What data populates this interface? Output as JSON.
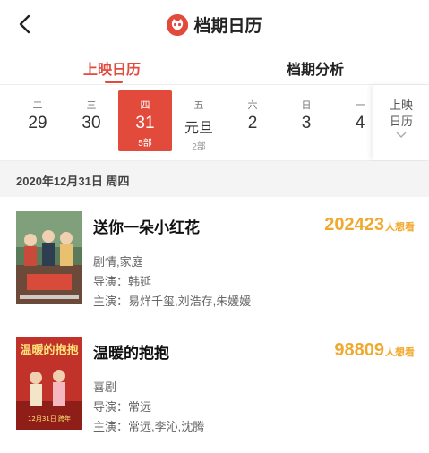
{
  "header": {
    "title": "档期日历",
    "back_icon": "back-arrow-icon",
    "logo_icon": "cat-eye-logo-icon"
  },
  "tabs": [
    {
      "label": "上映日历",
      "active": true
    },
    {
      "label": "档期分析",
      "active": false
    }
  ],
  "dates": [
    {
      "dow": "二",
      "num": "29",
      "sub": ""
    },
    {
      "dow": "三",
      "num": "30",
      "sub": ""
    },
    {
      "dow": "四",
      "num": "31",
      "sub": "5部",
      "active": true
    },
    {
      "dow": "五",
      "num": "元旦",
      "sub": "2部"
    },
    {
      "dow": "六",
      "num": "2",
      "sub": ""
    },
    {
      "dow": "日",
      "num": "3",
      "sub": ""
    },
    {
      "dow": "一",
      "num": "4",
      "sub": ""
    }
  ],
  "more": {
    "line1": "上映",
    "line2": "日历"
  },
  "date_header": "2020年12月31日 周四",
  "movies": [
    {
      "title": "送你一朵小红花",
      "want": "202423",
      "want_unit": "人想看",
      "genre": "剧情,家庭",
      "director": "导演：韩延",
      "cast": "主演：易烊千玺,刘浩存,朱媛媛"
    },
    {
      "title": "温暖的抱抱",
      "want": "98809",
      "want_unit": "人想看",
      "genre": "喜剧",
      "director": "导演：常远",
      "cast": "主演：常远,李沁,沈腾",
      "poster_text": "温暖的抱抱",
      "poster_date": "12月31日 跨年"
    }
  ],
  "colors": {
    "accent": "#e24a3c",
    "want": "#f0a92e"
  }
}
